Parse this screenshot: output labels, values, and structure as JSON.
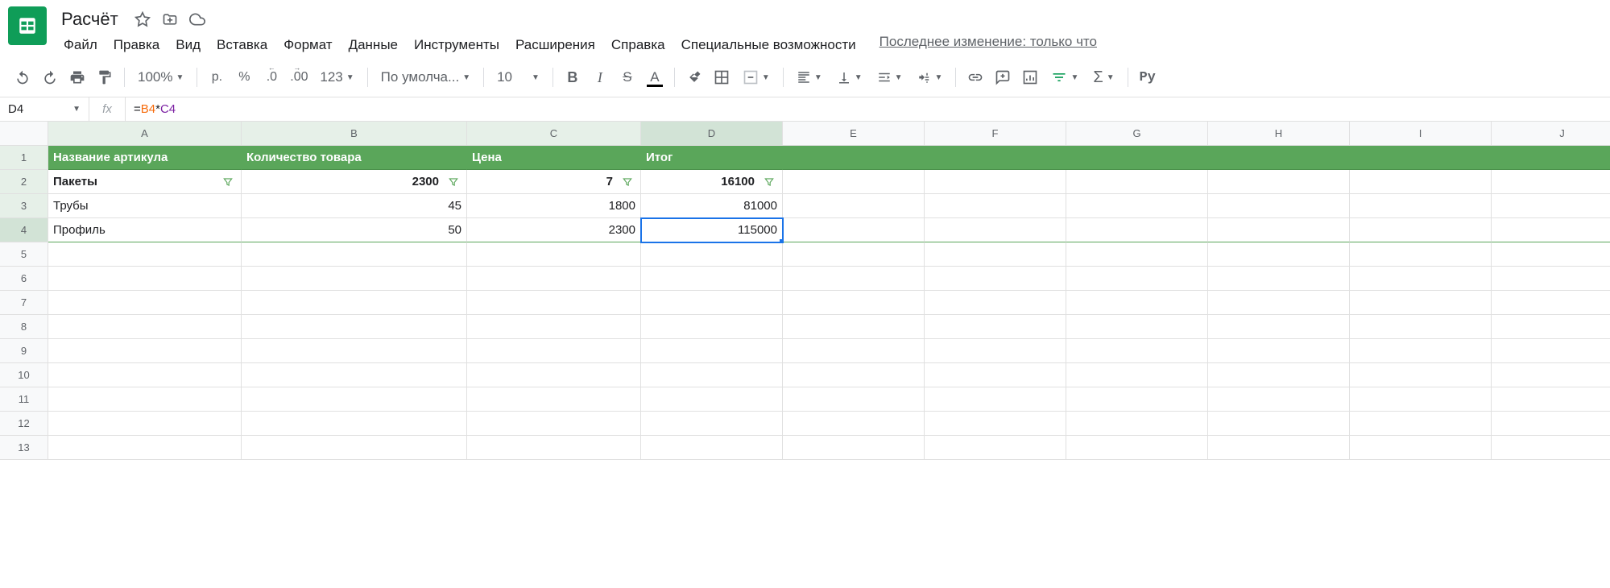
{
  "doc": {
    "title": "Расчёт"
  },
  "menus": [
    "Файл",
    "Правка",
    "Вид",
    "Вставка",
    "Формат",
    "Данные",
    "Инструменты",
    "Расширения",
    "Справка",
    "Специальные возможности"
  ],
  "last_edit": "Последнее изменение: только что",
  "toolbar": {
    "zoom": "100%",
    "currency": "р.",
    "percent": "%",
    "dec_dec": ".0",
    "inc_dec": ".00",
    "num_fmt": "123",
    "font": "По умолча...",
    "font_size": "10",
    "py": "Py"
  },
  "formula_bar": {
    "cell_ref": "D4",
    "fx": "fx",
    "ref1": "B4",
    "op1": "*",
    "ref2": "C4",
    "prefix": "="
  },
  "columns": [
    "A",
    "B",
    "C",
    "D",
    "E",
    "F",
    "G",
    "H",
    "I",
    "J"
  ],
  "row_nums": [
    "1",
    "2",
    "3",
    "4",
    "5",
    "6",
    "7",
    "8",
    "9",
    "10",
    "11",
    "12",
    "13"
  ],
  "headers": [
    "Название артикула",
    "Количество товара",
    "Цена",
    "Итог"
  ],
  "rows": [
    {
      "a": "Пакеты",
      "b": "2300",
      "c": "7",
      "d": "16100",
      "bold": true
    },
    {
      "a": "Трубы",
      "b": "45",
      "c": "1800",
      "d": "81000",
      "bold": false
    },
    {
      "a": "Профиль",
      "b": "50",
      "c": "2300",
      "d": "115000",
      "bold": false
    }
  ],
  "chart_data": {
    "type": "table",
    "columns": [
      "Название артикула",
      "Количество товара",
      "Цена",
      "Итог"
    ],
    "rows": [
      [
        "Пакеты",
        2300,
        7,
        16100
      ],
      [
        "Трубы",
        45,
        1800,
        81000
      ],
      [
        "Профиль",
        50,
        2300,
        115000
      ]
    ]
  }
}
